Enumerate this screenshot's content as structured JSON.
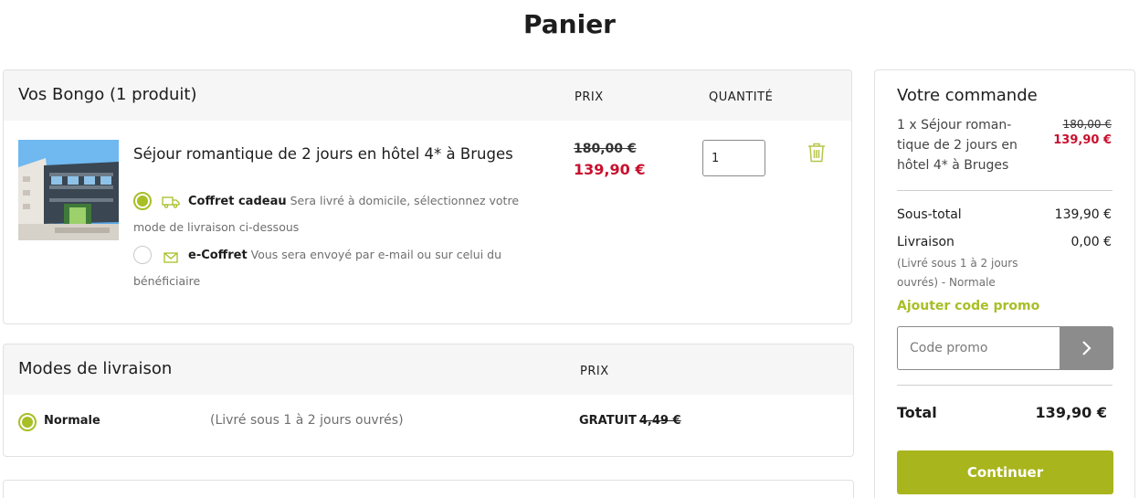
{
  "page_title": "Panier",
  "cart": {
    "title": "Vos Bongo (1 produit)",
    "col_price": "PRIX",
    "col_quantity": "QUANTITÉ",
    "product": {
      "name": "Séjour romantique de 2 jours en hôtel 4* à Bruges",
      "price_old": "180,00 €",
      "price_new": "139,90 €",
      "quantity": "1",
      "options": [
        {
          "title": "Coffret cadeau",
          "description": "Sera livré à domicile, sélectionnez votre mode de livraison ci-dessous",
          "selected": true,
          "icon": "truck-icon"
        },
        {
          "title": "e-Coffret",
          "description": "Vous sera envoyé par e-mail ou sur celui du bénéficiaire",
          "selected": false,
          "icon": "envelope-icon"
        }
      ]
    }
  },
  "delivery": {
    "title": "Modes de livraison",
    "col_price": "PRIX",
    "option": {
      "name": "Normale",
      "description": "(Livré sous 1 à 2 jours ouvrés)",
      "price_label": "GRATUIT",
      "price_old": "4,49 €",
      "selected": true
    }
  },
  "summary": {
    "title": "Votre commande",
    "item": "1 x Séjour roman-tique de 2 jours en hôtel 4* à Bruges",
    "item_price_old": "180,00 €",
    "item_price_new": "139,90 €",
    "subtotal_label": "Sous-total",
    "subtotal_value": "139,90 €",
    "shipping_label": "Livraison",
    "shipping_value": "0,00 €",
    "shipping_note": "(Livré sous 1 à 2 jours ouvrés) - Normale",
    "promo_link": "Ajouter code promo",
    "promo_placeholder": "Code promo",
    "total_label": "Total",
    "total_value": "139,90 €",
    "continue_label": "Continuer"
  },
  "colors": {
    "accent": "#a8bf26",
    "button": "#a8b51c",
    "price_red": "#c8102e"
  }
}
